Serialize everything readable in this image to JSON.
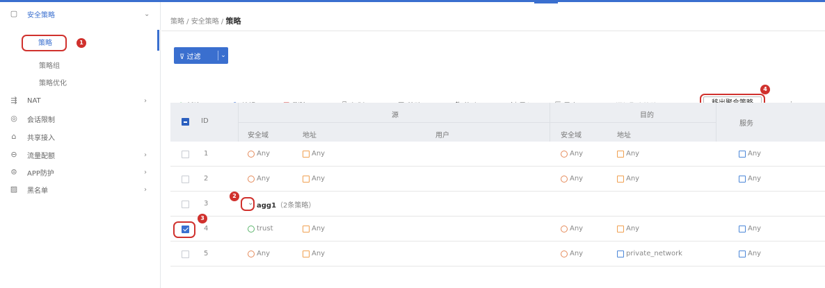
{
  "sidebar": {
    "security_policy": "安全策略",
    "policy": "策略",
    "policy_group": "策略组",
    "policy_optimize": "策略优化",
    "nat": "NAT",
    "session_limit": "会话限制",
    "shared_access": "共享接入",
    "traffic_control": "流量配额",
    "app_protect": "APP防护",
    "blacklist": "黑名单"
  },
  "breadcrumb": {
    "path": "策略 / 安全策略 / ",
    "current": "策略"
  },
  "filter": {
    "label": "过滤"
  },
  "toolbar": {
    "new": "新建",
    "edit": "编辑",
    "delete": "删除",
    "copy": "复制",
    "paste": "粘贴",
    "move": "移动",
    "import": "导入",
    "export": "导出",
    "add_to_aggregate": "添加聚合策略",
    "remove_from_aggregate": "移出聚合策略"
  },
  "annotations": {
    "badge1": "1",
    "badge2": "2",
    "badge3": "3",
    "badge4": "4"
  },
  "table": {
    "headers": {
      "id": "ID",
      "source": "源",
      "destination": "目的",
      "service": "服务",
      "src_zone": "安全域",
      "src_addr": "地址",
      "src_user": "用户",
      "dst_zone": "安全域",
      "dst_addr": "地址"
    },
    "rows": [
      {
        "id": "1",
        "src_zone": "Any",
        "src_addr": "Any",
        "dst_zone": "Any",
        "dst_addr": "Any",
        "service": "Any"
      },
      {
        "id": "2",
        "src_zone": "Any",
        "src_addr": "Any",
        "dst_zone": "Any",
        "dst_addr": "Any",
        "service": "Any"
      },
      {
        "id": "3",
        "group_name": "agg1",
        "group_note": "（2条策略）"
      },
      {
        "id": "4",
        "src_zone": "trust",
        "src_addr": "Any",
        "dst_zone": "Any",
        "dst_addr": "Any",
        "service": "Any"
      },
      {
        "id": "5",
        "src_zone": "Any",
        "src_addr": "Any",
        "dst_zone": "Any",
        "dst_addr": "private_network",
        "service": "Any"
      }
    ]
  },
  "colors": {
    "accent": "#3a6fcf",
    "annotation_red": "#d0312d",
    "zone_orange": "#e58a5a",
    "zone_green": "#5bb56b",
    "addr_orange": "#f0a050",
    "addr_blue": "#4a86d8",
    "service_blue": "#4a86d8"
  }
}
